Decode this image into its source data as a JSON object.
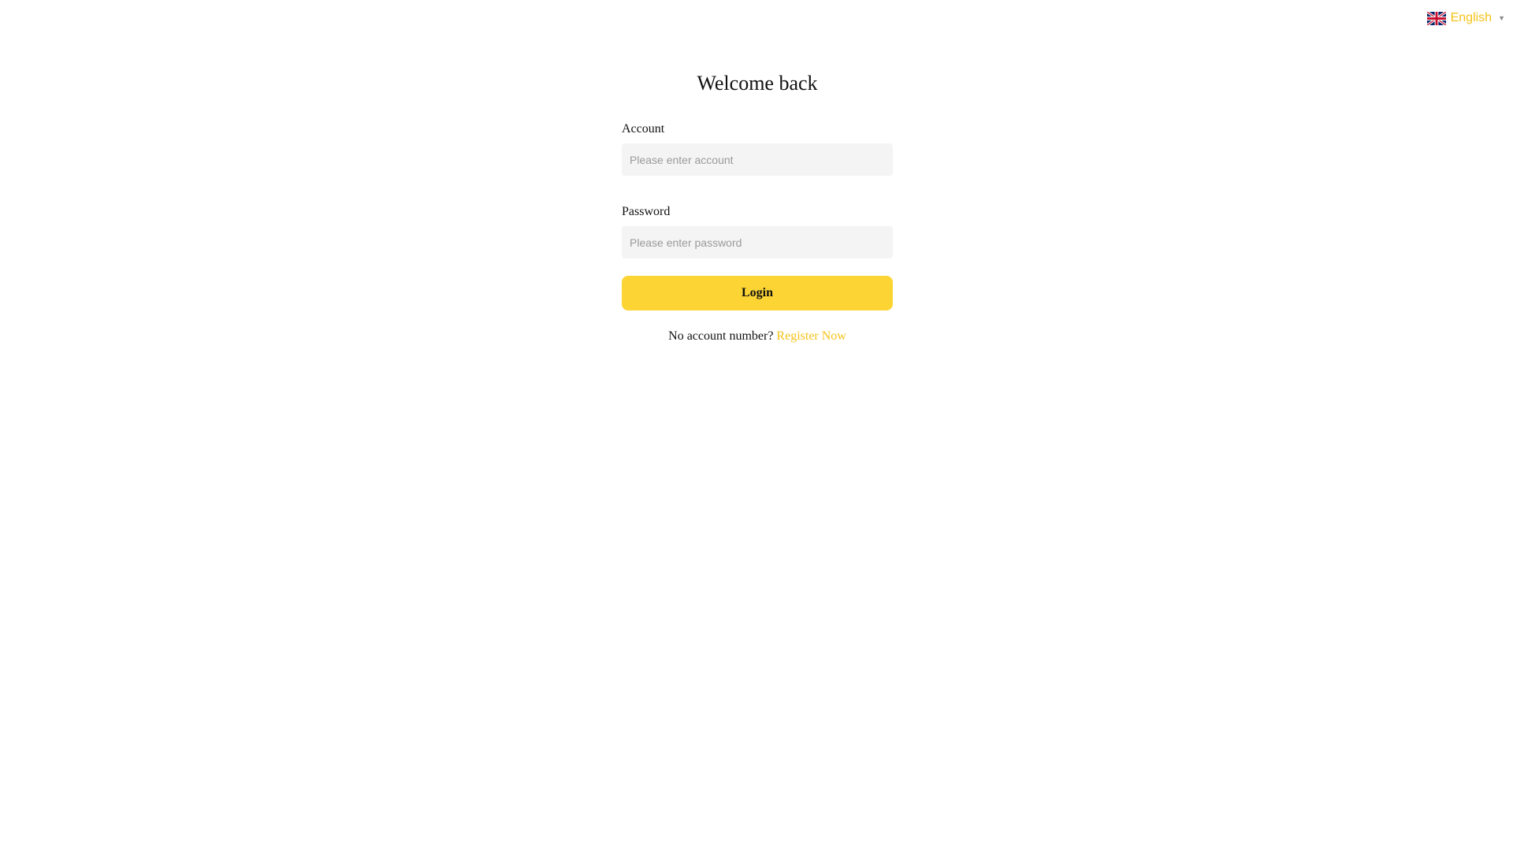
{
  "language": {
    "label": "English",
    "flag_icon": "uk-flag-icon",
    "caret_icon": "caret-down-icon",
    "caret_glyph": "▼"
  },
  "login": {
    "title": "Welcome back",
    "account": {
      "label": "Account",
      "placeholder": "Please enter account",
      "value": ""
    },
    "password": {
      "label": "Password",
      "placeholder": "Please enter password",
      "value": ""
    },
    "submit_label": "Login",
    "register_prompt": "No account number?",
    "register_link": "Register Now"
  },
  "colors": {
    "accent": "#fcd535",
    "link": "#f5c218",
    "input_bg": "#f4f4f4",
    "placeholder": "#9a9a9a"
  }
}
